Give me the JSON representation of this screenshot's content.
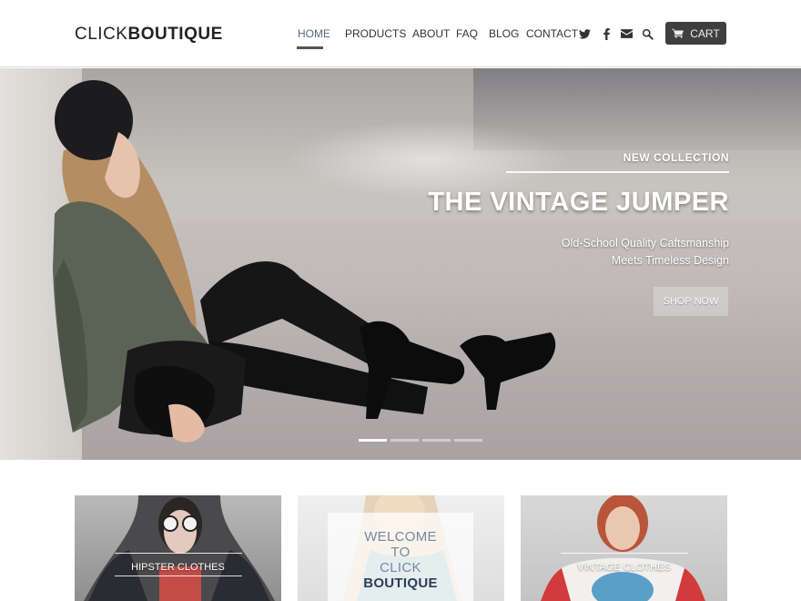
{
  "brand": {
    "logo_light": "CLICK",
    "logo_bold": "BOUTIQUE"
  },
  "nav": {
    "items": [
      {
        "label": "HOME",
        "active": true
      },
      {
        "label": "PRODUCTS",
        "active": false
      },
      {
        "label": "ABOUT",
        "active": false
      },
      {
        "label": "FAQ",
        "active": false
      },
      {
        "label": "BLOG",
        "active": false
      },
      {
        "label": "CONTACT",
        "active": false
      }
    ],
    "icons": [
      "twitter-icon",
      "facebook-icon",
      "mail-icon",
      "search-icon"
    ],
    "cart_label": "CART"
  },
  "hero": {
    "kicker": "NEW COLLECTION",
    "title": "THE VINTAGE JUMPER",
    "subtitle_line1": "Old-School Quality Caftsmanship",
    "subtitle_line2": "Meets Timeless Design",
    "cta": "SHOP NOW",
    "slides_total": 4,
    "active_slide": 1
  },
  "tiles": [
    {
      "label": "HIPSTER CLOTHES"
    },
    {
      "welcome": [
        "WELCOME",
        "TO",
        "CLICK",
        "BOUTIQUE"
      ]
    },
    {
      "label": "VINTAGE CLOTHES"
    }
  ],
  "colors": {
    "accent_nav": "#556a88",
    "cart_bg": "#3f3f3f",
    "welcome_dark": "#2f3d55",
    "welcome_light": "#7588a3"
  }
}
